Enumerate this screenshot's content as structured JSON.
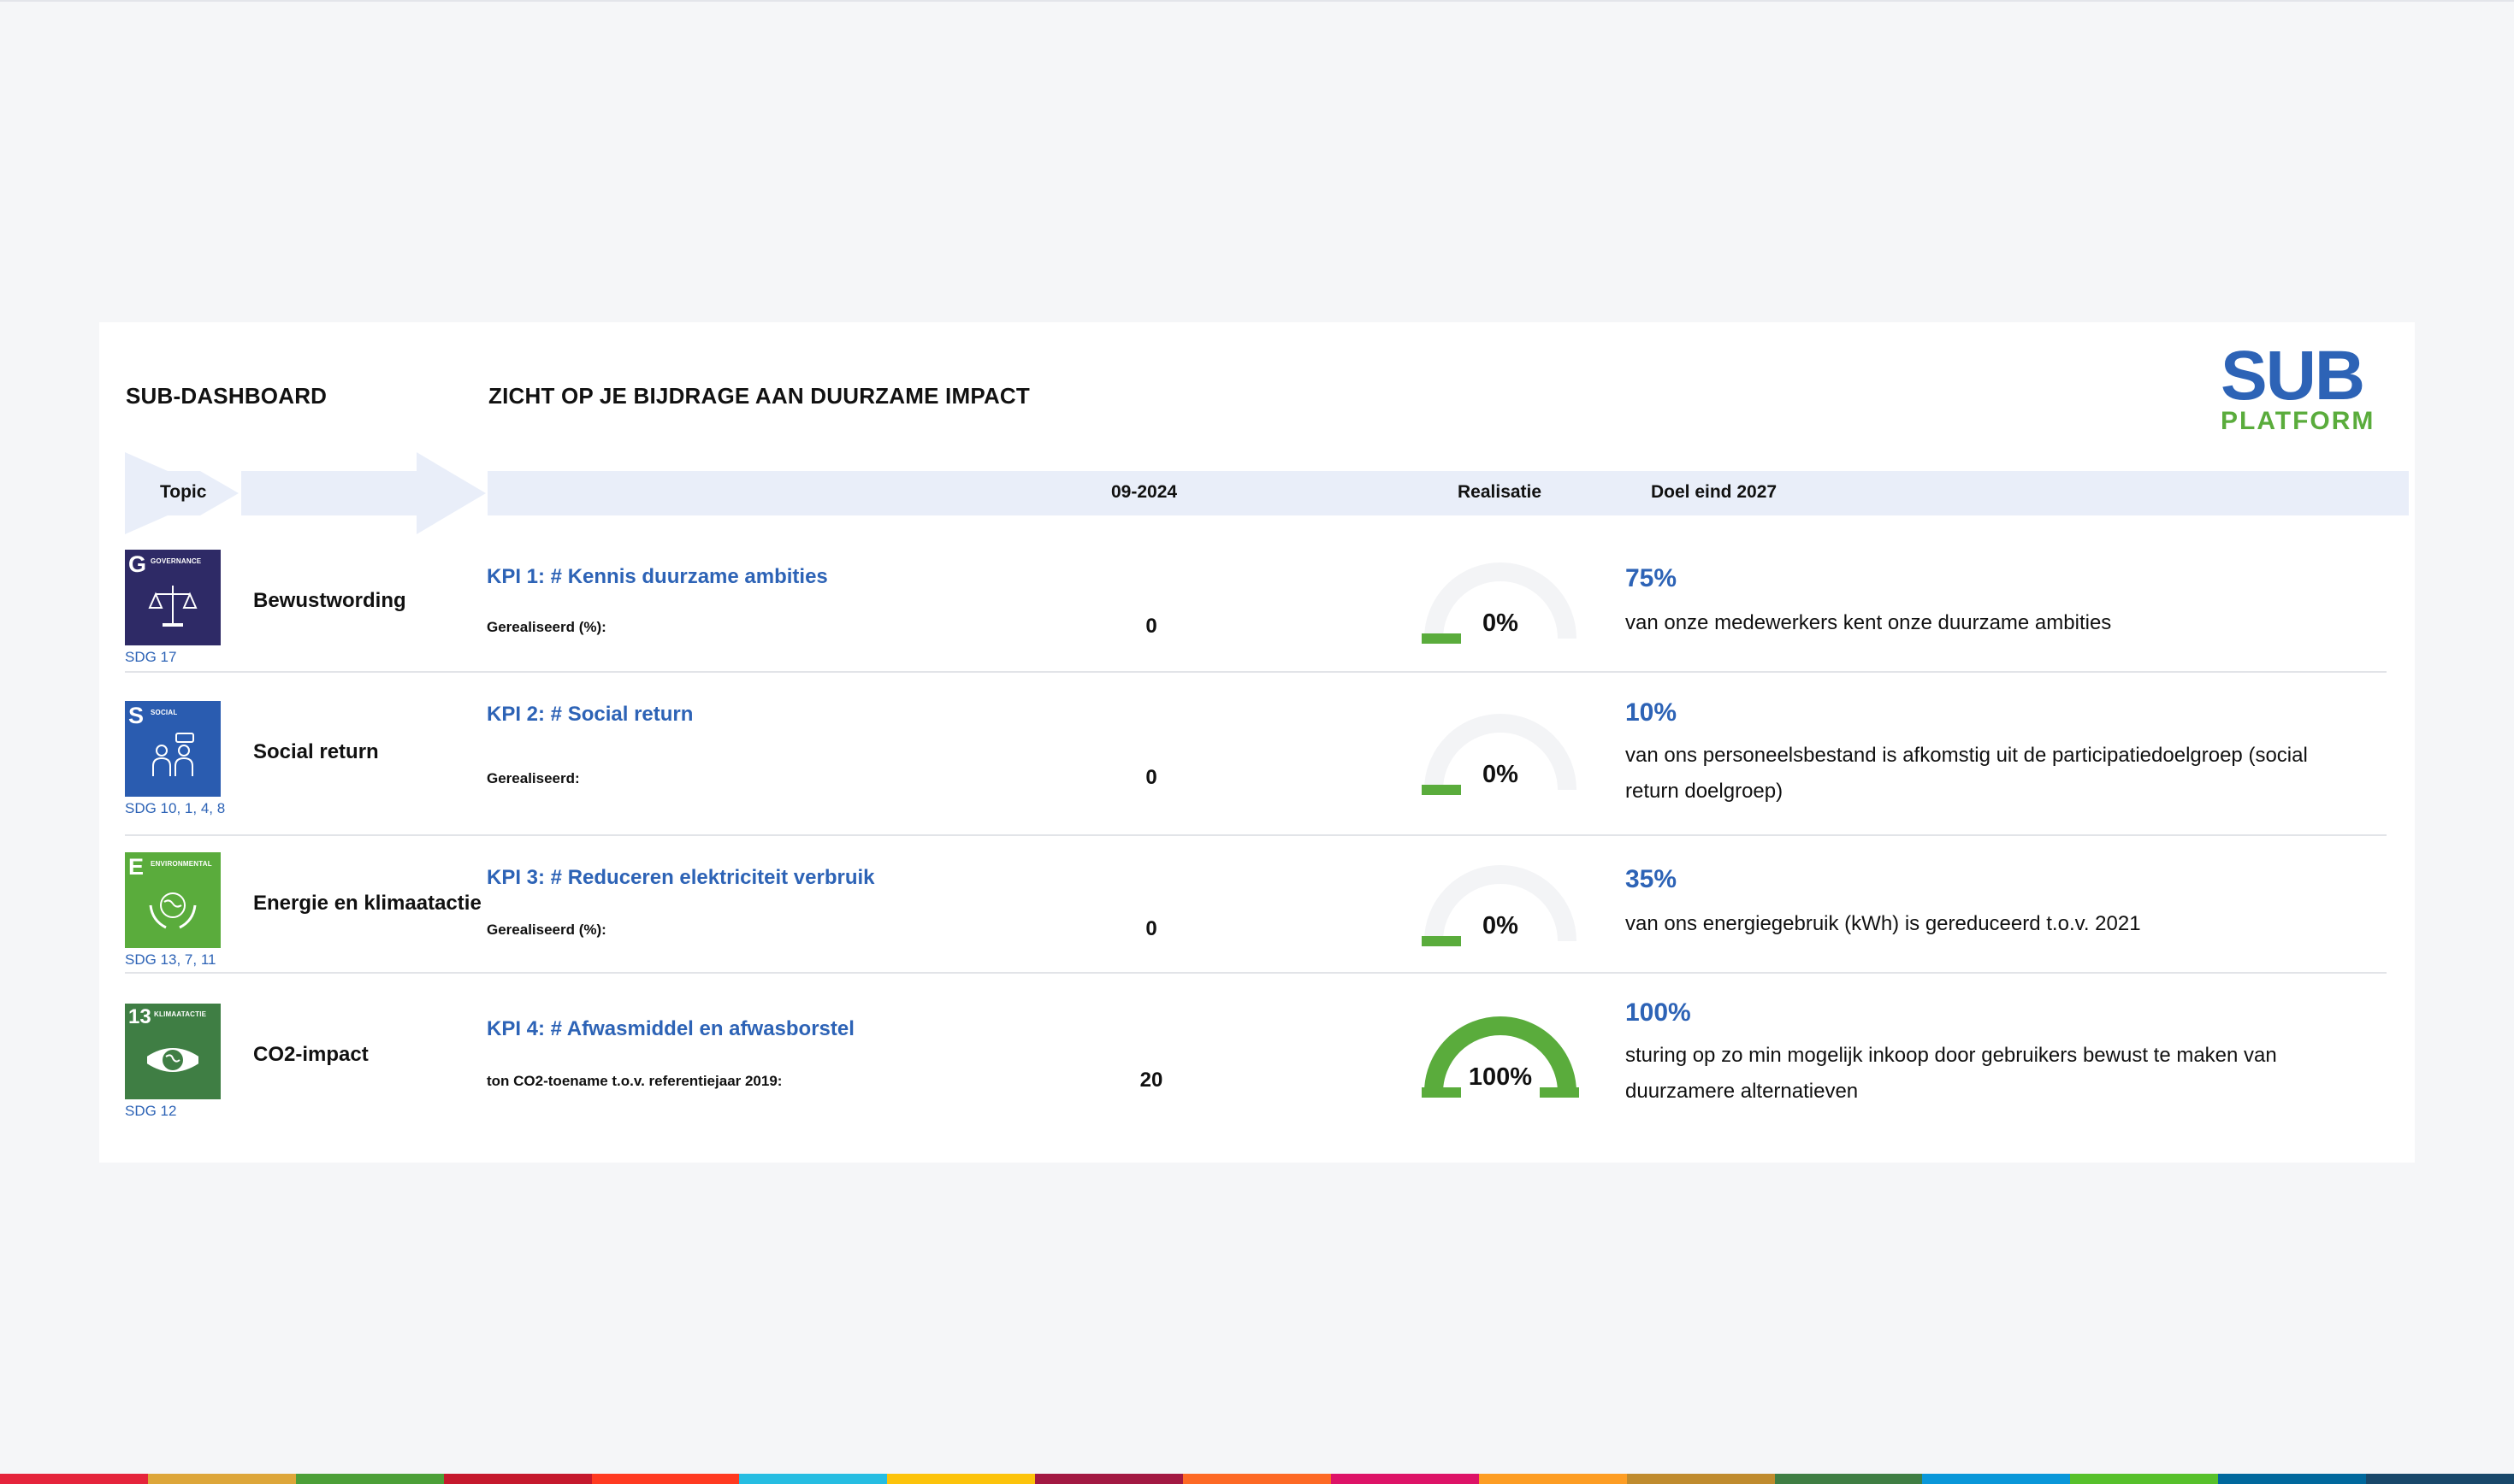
{
  "header": {
    "dashboard_title": "SUB-DASHBOARD",
    "subtitle": "ZICHT OP JE BIJDRAGE AAN DUURZAME IMPACT",
    "logo_top": "SUB",
    "logo_bottom": "PLATFORM"
  },
  "columns": {
    "topic": "Topic",
    "period": "09-2024",
    "realisatie": "Realisatie",
    "doel": "Doel eind 2027"
  },
  "rows": [
    {
      "tile_letter": "G",
      "tile_label": "GOVERNANCE",
      "tile_color": "#2e2a66",
      "sdg": "SDG 17",
      "topic": "Bewustwording",
      "kpi_title": "KPI 1: # Kennis duurzame ambities",
      "kpi_label": "Gerealiseerd (%):",
      "value": "0",
      "gauge_percent": 0,
      "gauge_text": "0%",
      "goal_pct": "75%",
      "goal_text": "van onze medewerkers kent onze duurzame ambities",
      "icon": "scales-icon"
    },
    {
      "tile_letter": "S",
      "tile_label": "SOCIAL",
      "tile_color": "#2a5cb0",
      "sdg": "SDG 10, 1, 4, 8",
      "topic": "Social return",
      "kpi_title": "KPI 2: # Social return",
      "kpi_label": "Gerealiseerd:",
      "value": "0",
      "gauge_percent": 0,
      "gauge_text": "0%",
      "goal_pct": "10%",
      "goal_text": "van ons personeelsbestand is afkomstig uit de participatiedoelgroep (social return doelgroep)",
      "icon": "people-icon"
    },
    {
      "tile_letter": "E",
      "tile_label": "ENVIRONMENTAL",
      "tile_color": "#5aac3c",
      "sdg": "SDG 13, 7, 11",
      "topic": "Energie en klimaatactie",
      "kpi_title": "KPI 3: # Reduceren elektriciteit verbruik",
      "kpi_label": "Gerealiseerd (%):",
      "value": "0",
      "gauge_percent": 0,
      "gauge_text": "0%",
      "goal_pct": "35%",
      "goal_text": "van ons energiegebruik (kWh) is gereduceerd t.o.v. 2021",
      "icon": "globe-hands-icon"
    },
    {
      "tile_letter": "13",
      "tile_label": "KLIMAATACTIE",
      "tile_color": "#3f7e44",
      "sdg": "SDG 12",
      "topic": "CO2-impact",
      "kpi_title": "KPI 4: # Afwasmiddel en afwasborstel",
      "kpi_label": "ton CO2-toename t.o.v. referentiejaar 2019:",
      "value": "20",
      "gauge_percent": 100,
      "gauge_text": "100%",
      "goal_pct": "100%",
      "goal_text": "sturing op zo min mogelijk inkoop door gebruikers bewust te maken van duurzamere alternatieven",
      "icon": "eye-globe-icon"
    }
  ],
  "colors": {
    "accent_blue": "#2d63b6",
    "gauge_green": "#5aac3c",
    "gauge_track": "#f3f4f6",
    "arrow_band": "#e9eef9"
  }
}
